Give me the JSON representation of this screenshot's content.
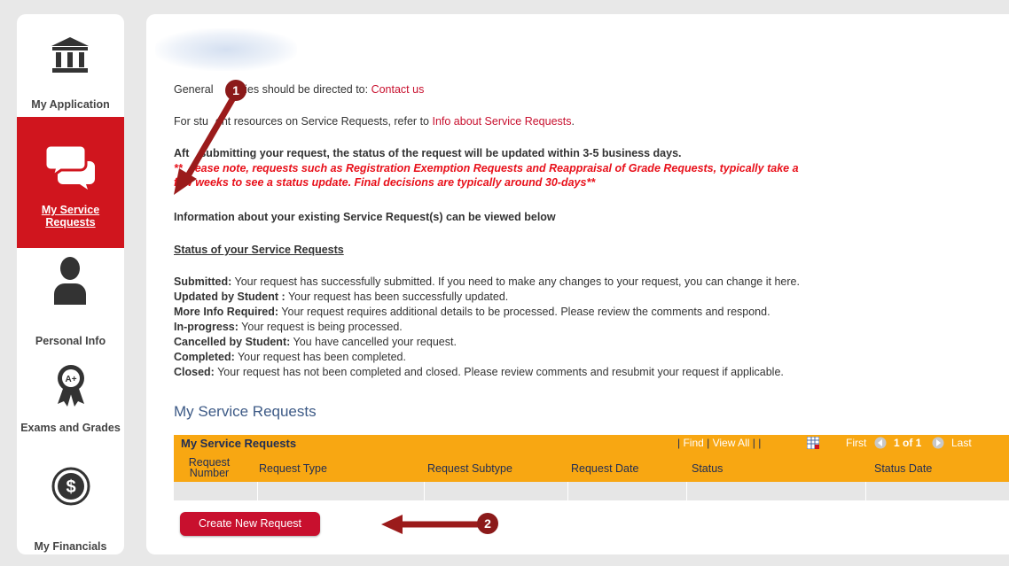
{
  "sidebar": {
    "items": [
      {
        "label": "My Application",
        "icon": "bank-icon"
      },
      {
        "label": "My Service Requests",
        "icon": "chat-bubbles-icon",
        "active": true
      },
      {
        "label": "Personal Info",
        "icon": "person-icon"
      },
      {
        "label": "Exams and Grades",
        "icon": "award-ribbon-icon"
      },
      {
        "label": "My Financials",
        "icon": "dollar-coin-icon"
      }
    ]
  },
  "content": {
    "general_prefix": "General ",
    "general_mid": "ries should be directed to: ",
    "contact_link": "Contact us",
    "resources_prefix": "For stu",
    "resources_mid": "ent resources on Service Requests, refer to ",
    "resources_link": "Info about Service Requests",
    "resources_suffix": ".",
    "after_prefix": "Aft",
    "after_rest": "submitting your request, the status of the request will be updated within 3-5 business days.",
    "note_line1_prefix": "**",
    "note_line1_rest": "ease note, requests such as Registration Exemption Requests and Reappraisal of Grade Requests, typically take a",
    "note_line2": "few weeks to see a status update. Final decisions are typically around 30-days**",
    "info_existing": "Information about your existing Service Request(s) can be viewed below",
    "status_heading": "Status of your Service Requests",
    "statuses": [
      {
        "term": "Submitted:",
        "desc": " Your request has successfully submitted. If you need to make any changes to your request, you can change it here."
      },
      {
        "term": "Updated by Student :",
        "desc": " Your request has been successfully updated."
      },
      {
        "term": "More Info Required:",
        "desc": " Your request requires additional details to be processed. Please review the comments and respond."
      },
      {
        "term": "In-progress:",
        "desc": " Your request is being processed."
      },
      {
        "term": "Cancelled by Student:",
        "desc": " You have cancelled your request."
      },
      {
        "term": "Completed:",
        "desc": " Your request has been completed."
      },
      {
        "term": "Closed:",
        "desc": " Your request has not been completed and closed. Please review comments and resubmit your request if applicable."
      }
    ]
  },
  "requests": {
    "section_title": "My Service Requests",
    "grid_title": "My Service Requests",
    "find": "Find",
    "view_all": "View All",
    "first": "First",
    "page_info": "1 of 1",
    "last": "Last",
    "columns": [
      "Request Number",
      "Request Type",
      "Request Subtype",
      "Request Date",
      "Status",
      "Status Date"
    ],
    "create_button": "Create New Request"
  },
  "callouts": {
    "one": "1",
    "two": "2"
  },
  "colors": {
    "accent": "#c8102e",
    "grid_header": "#f8a712",
    "note_red": "#e8101a",
    "callout": "#8b1a1a"
  }
}
